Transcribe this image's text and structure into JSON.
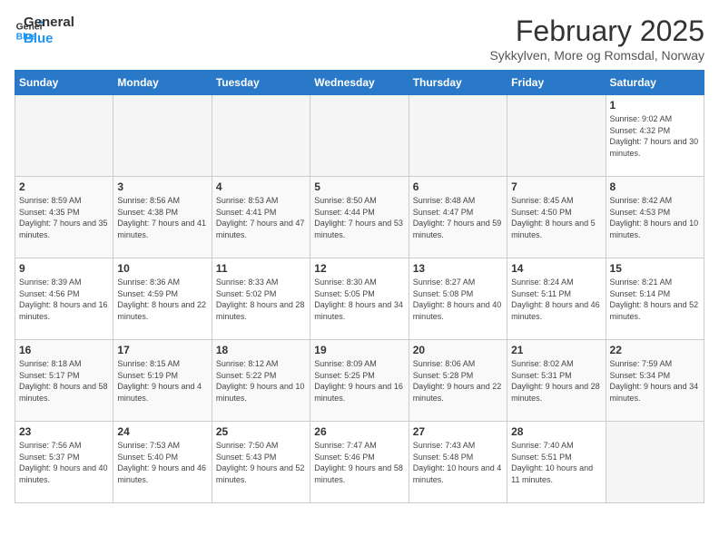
{
  "logo": {
    "text_general": "General",
    "text_blue": "Blue"
  },
  "title": "February 2025",
  "location": "Sykkylven, More og Romsdal, Norway",
  "weekdays": [
    "Sunday",
    "Monday",
    "Tuesday",
    "Wednesday",
    "Thursday",
    "Friday",
    "Saturday"
  ],
  "weeks": [
    [
      {
        "day": "",
        "info": ""
      },
      {
        "day": "",
        "info": ""
      },
      {
        "day": "",
        "info": ""
      },
      {
        "day": "",
        "info": ""
      },
      {
        "day": "",
        "info": ""
      },
      {
        "day": "",
        "info": ""
      },
      {
        "day": "1",
        "info": "Sunrise: 9:02 AM\nSunset: 4:32 PM\nDaylight: 7 hours and 30 minutes."
      }
    ],
    [
      {
        "day": "2",
        "info": "Sunrise: 8:59 AM\nSunset: 4:35 PM\nDaylight: 7 hours and 35 minutes."
      },
      {
        "day": "3",
        "info": "Sunrise: 8:56 AM\nSunset: 4:38 PM\nDaylight: 7 hours and 41 minutes."
      },
      {
        "day": "4",
        "info": "Sunrise: 8:53 AM\nSunset: 4:41 PM\nDaylight: 7 hours and 47 minutes."
      },
      {
        "day": "5",
        "info": "Sunrise: 8:50 AM\nSunset: 4:44 PM\nDaylight: 7 hours and 53 minutes."
      },
      {
        "day": "6",
        "info": "Sunrise: 8:48 AM\nSunset: 4:47 PM\nDaylight: 7 hours and 59 minutes."
      },
      {
        "day": "7",
        "info": "Sunrise: 8:45 AM\nSunset: 4:50 PM\nDaylight: 8 hours and 5 minutes."
      },
      {
        "day": "8",
        "info": "Sunrise: 8:42 AM\nSunset: 4:53 PM\nDaylight: 8 hours and 10 minutes."
      }
    ],
    [
      {
        "day": "9",
        "info": "Sunrise: 8:39 AM\nSunset: 4:56 PM\nDaylight: 8 hours and 16 minutes."
      },
      {
        "day": "10",
        "info": "Sunrise: 8:36 AM\nSunset: 4:59 PM\nDaylight: 8 hours and 22 minutes."
      },
      {
        "day": "11",
        "info": "Sunrise: 8:33 AM\nSunset: 5:02 PM\nDaylight: 8 hours and 28 minutes."
      },
      {
        "day": "12",
        "info": "Sunrise: 8:30 AM\nSunset: 5:05 PM\nDaylight: 8 hours and 34 minutes."
      },
      {
        "day": "13",
        "info": "Sunrise: 8:27 AM\nSunset: 5:08 PM\nDaylight: 8 hours and 40 minutes."
      },
      {
        "day": "14",
        "info": "Sunrise: 8:24 AM\nSunset: 5:11 PM\nDaylight: 8 hours and 46 minutes."
      },
      {
        "day": "15",
        "info": "Sunrise: 8:21 AM\nSunset: 5:14 PM\nDaylight: 8 hours and 52 minutes."
      }
    ],
    [
      {
        "day": "16",
        "info": "Sunrise: 8:18 AM\nSunset: 5:17 PM\nDaylight: 8 hours and 58 minutes."
      },
      {
        "day": "17",
        "info": "Sunrise: 8:15 AM\nSunset: 5:19 PM\nDaylight: 9 hours and 4 minutes."
      },
      {
        "day": "18",
        "info": "Sunrise: 8:12 AM\nSunset: 5:22 PM\nDaylight: 9 hours and 10 minutes."
      },
      {
        "day": "19",
        "info": "Sunrise: 8:09 AM\nSunset: 5:25 PM\nDaylight: 9 hours and 16 minutes."
      },
      {
        "day": "20",
        "info": "Sunrise: 8:06 AM\nSunset: 5:28 PM\nDaylight: 9 hours and 22 minutes."
      },
      {
        "day": "21",
        "info": "Sunrise: 8:02 AM\nSunset: 5:31 PM\nDaylight: 9 hours and 28 minutes."
      },
      {
        "day": "22",
        "info": "Sunrise: 7:59 AM\nSunset: 5:34 PM\nDaylight: 9 hours and 34 minutes."
      }
    ],
    [
      {
        "day": "23",
        "info": "Sunrise: 7:56 AM\nSunset: 5:37 PM\nDaylight: 9 hours and 40 minutes."
      },
      {
        "day": "24",
        "info": "Sunrise: 7:53 AM\nSunset: 5:40 PM\nDaylight: 9 hours and 46 minutes."
      },
      {
        "day": "25",
        "info": "Sunrise: 7:50 AM\nSunset: 5:43 PM\nDaylight: 9 hours and 52 minutes."
      },
      {
        "day": "26",
        "info": "Sunrise: 7:47 AM\nSunset: 5:46 PM\nDaylight: 9 hours and 58 minutes."
      },
      {
        "day": "27",
        "info": "Sunrise: 7:43 AM\nSunset: 5:48 PM\nDaylight: 10 hours and 4 minutes."
      },
      {
        "day": "28",
        "info": "Sunrise: 7:40 AM\nSunset: 5:51 PM\nDaylight: 10 hours and 11 minutes."
      },
      {
        "day": "",
        "info": ""
      }
    ]
  ]
}
